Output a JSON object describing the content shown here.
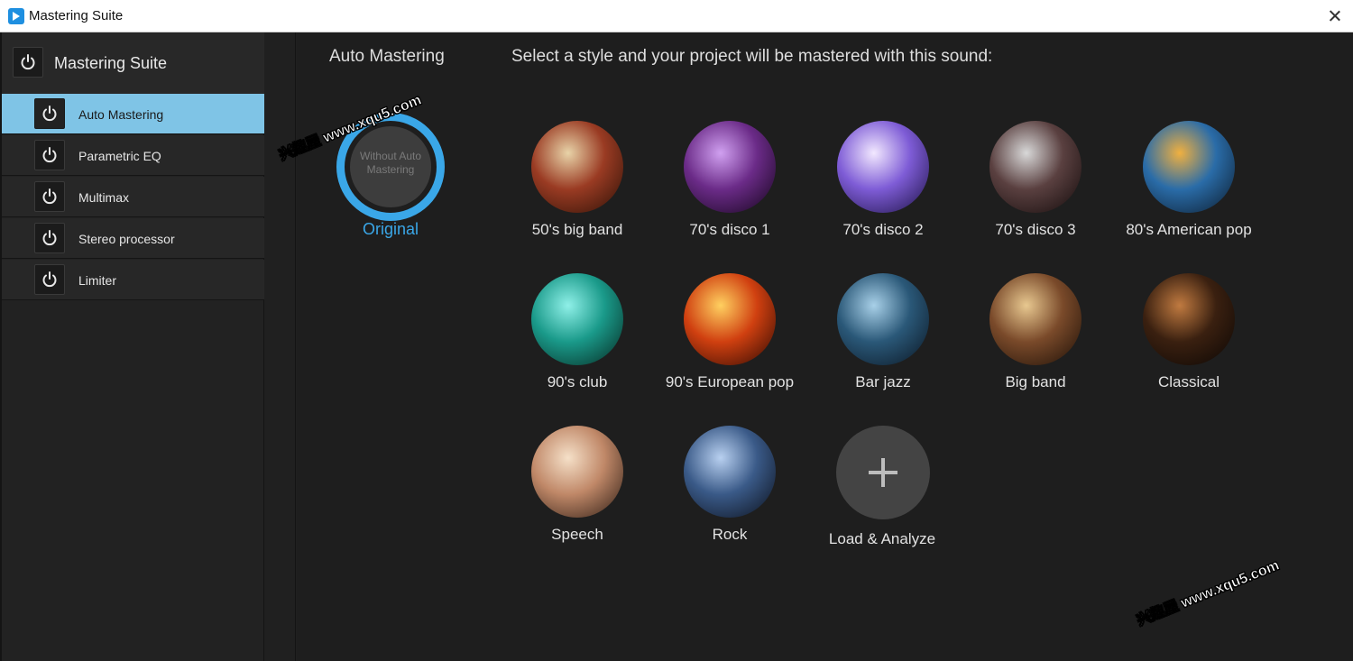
{
  "window": {
    "title": "Mastering Suite"
  },
  "sidebar": {
    "title": "Mastering Suite",
    "items": [
      {
        "label": "Auto Mastering",
        "active": true
      },
      {
        "label": "Parametric EQ",
        "active": false
      },
      {
        "label": "Multimax",
        "active": false
      },
      {
        "label": "Stereo processor",
        "active": false
      },
      {
        "label": "Limiter",
        "active": false
      }
    ]
  },
  "main": {
    "section_title": "Auto Mastering",
    "instruction": "Select a style and your project will be mastered with this sound:",
    "original": {
      "caption": "Without Auto Mastering",
      "label": "Original"
    },
    "styles": [
      {
        "label": "50's big band",
        "icon": "saxophone-photo",
        "colors": [
          "#e8d3a8",
          "#9a3b23",
          "#2a1006"
        ]
      },
      {
        "label": "70's disco 1",
        "icon": "disco-ball-photo",
        "colors": [
          "#d0a0f0",
          "#6b2b88",
          "#120418"
        ]
      },
      {
        "label": "70's disco 2",
        "icon": "dancer-photo",
        "colors": [
          "#f2e8ff",
          "#7e5cd6",
          "#1a1040"
        ]
      },
      {
        "label": "70's disco 3",
        "icon": "disco-ball-dancer-photo",
        "colors": [
          "#d8d8d8",
          "#5a4040",
          "#120a0a"
        ]
      },
      {
        "label": "80's American pop",
        "icon": "pop-singer-photo",
        "colors": [
          "#f0b040",
          "#2a6ca8",
          "#0c1a2a"
        ]
      },
      {
        "label": "90's club",
        "icon": "club-dancer-photo",
        "colors": [
          "#8ff0e8",
          "#1a9a8a",
          "#06261e"
        ]
      },
      {
        "label": "90's European pop",
        "icon": "fire-dancer-photo",
        "colors": [
          "#ffd060",
          "#d04010",
          "#2a0802"
        ]
      },
      {
        "label": "Bar jazz",
        "icon": "trumpet-player-photo",
        "colors": [
          "#a8d0e8",
          "#2a5878",
          "#0a1420"
        ]
      },
      {
        "label": "Big band",
        "icon": "trombones-photo",
        "colors": [
          "#e8c890",
          "#7a4a2a",
          "#1a0e06"
        ]
      },
      {
        "label": "Classical",
        "icon": "violin-photo",
        "colors": [
          "#c07a40",
          "#3a2010",
          "#0a0604"
        ]
      },
      {
        "label": "Speech",
        "icon": "microphone-mouth-photo",
        "colors": [
          "#f5e0c8",
          "#c08868",
          "#2a1a12"
        ]
      },
      {
        "label": "Rock",
        "icon": "electric-guitar-photo",
        "colors": [
          "#b8d0f0",
          "#3a5a88",
          "#0a0e18"
        ]
      }
    ],
    "load": {
      "label": "Load & Analyze"
    }
  },
  "watermarks": [
    "兴趣屋 www.xqu5.com",
    "兴趣屋 www.xqu5.com"
  ],
  "colors": {
    "accent": "#3aa7e8",
    "active_item": "#7fc4e6",
    "background": "#1e1e1e"
  }
}
